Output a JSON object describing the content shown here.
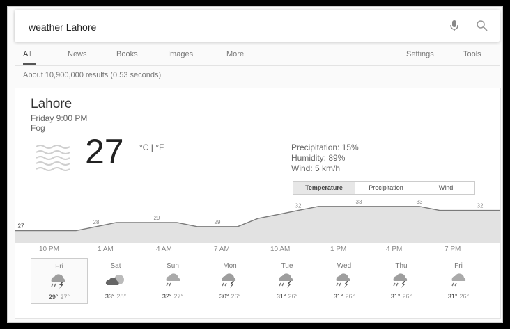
{
  "search": {
    "query": "weather Lahore"
  },
  "tabs": {
    "all": "All",
    "news": "News",
    "books": "Books",
    "images": "Images",
    "more": "More",
    "settings": "Settings",
    "tools": "Tools"
  },
  "result_stats": "About 10,900,000 results (0.53 seconds)",
  "weather": {
    "city": "Lahore",
    "datetime": "Friday 9:00 PM",
    "condition": "Fog",
    "temp": "27",
    "units": "°C | °F",
    "precipitation": "Precipitation: 15%",
    "humidity": "Humidity: 89%",
    "wind": "Wind: 5 km/h",
    "toggle": {
      "temperature": "Temperature",
      "precipitation": "Precipitation",
      "wind": "Wind"
    },
    "hours": [
      "10 PM",
      "1 AM",
      "4 AM",
      "7 AM",
      "10 AM",
      "1 PM",
      "4 PM",
      "7 PM"
    ],
    "days": [
      {
        "name": "Fri",
        "hi": "29°",
        "lo": "27°",
        "icon": "thunderstorm-icon"
      },
      {
        "name": "Sat",
        "hi": "33°",
        "lo": "28°",
        "icon": "partly-cloudy-icon"
      },
      {
        "name": "Sun",
        "hi": "32°",
        "lo": "27°",
        "icon": "rain-cloud-icon"
      },
      {
        "name": "Mon",
        "hi": "30°",
        "lo": "26°",
        "icon": "thunderstorm-icon"
      },
      {
        "name": "Tue",
        "hi": "31°",
        "lo": "26°",
        "icon": "thunderstorm-icon"
      },
      {
        "name": "Wed",
        "hi": "31°",
        "lo": "26°",
        "icon": "thunderstorm-icon"
      },
      {
        "name": "Thu",
        "hi": "31°",
        "lo": "26°",
        "icon": "thunderstorm-icon"
      },
      {
        "name": "Fri",
        "hi": "31°",
        "lo": "26°",
        "icon": "rain-cloud-icon"
      }
    ]
  },
  "chart_data": {
    "type": "area",
    "x": [
      "9 PM",
      "10 PM",
      "11 PM",
      "12 AM",
      "1 AM",
      "2 AM",
      "3 AM",
      "4 AM",
      "5 AM",
      "6 AM",
      "7 AM",
      "8 AM",
      "9 AM",
      "10 AM",
      "11 AM",
      "12 PM",
      "1 PM",
      "2 PM",
      "3 PM",
      "4 PM",
      "5 PM",
      "6 PM",
      "7 PM",
      "8 PM",
      "9 PM"
    ],
    "values": [
      27,
      27,
      27,
      27,
      28,
      29,
      29,
      29,
      29,
      28,
      28,
      28,
      30,
      31,
      32,
      33,
      33,
      33,
      33,
      33,
      33,
      32,
      32,
      32,
      32
    ],
    "labels": [
      "27",
      "28",
      "29",
      "29",
      "32",
      "33",
      "33",
      "32"
    ],
    "label_indices": [
      0,
      4,
      7,
      10,
      14,
      17,
      20,
      23
    ],
    "colors": {
      "fill": "#e2e2e2",
      "line": "#7a7a7a"
    }
  }
}
